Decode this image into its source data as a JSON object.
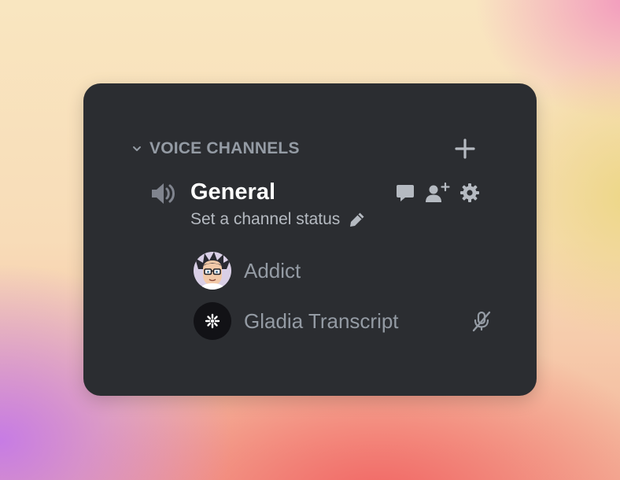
{
  "category": {
    "label": "VOICE CHANNELS",
    "collapse_icon": "chevron-down-icon",
    "add_icon": "plus-icon"
  },
  "channel": {
    "name": "General",
    "type_icon": "speaker-icon",
    "status_placeholder": "Set a channel status",
    "status_icon": "pencil-icon",
    "actions": [
      "chat-bubble-icon",
      "invite-user-icon",
      "gear-icon"
    ]
  },
  "members": [
    {
      "name": "Addict",
      "avatar": "cartoon-avatar"
    },
    {
      "name": "Gladia Transcript",
      "avatar": "gladia-logo-avatar",
      "status_icon": "mic-muted-icon"
    }
  ],
  "colors": {
    "panel": "#2b2d31",
    "muted_text": "#949ba4",
    "channel_name": "#ffffff"
  }
}
